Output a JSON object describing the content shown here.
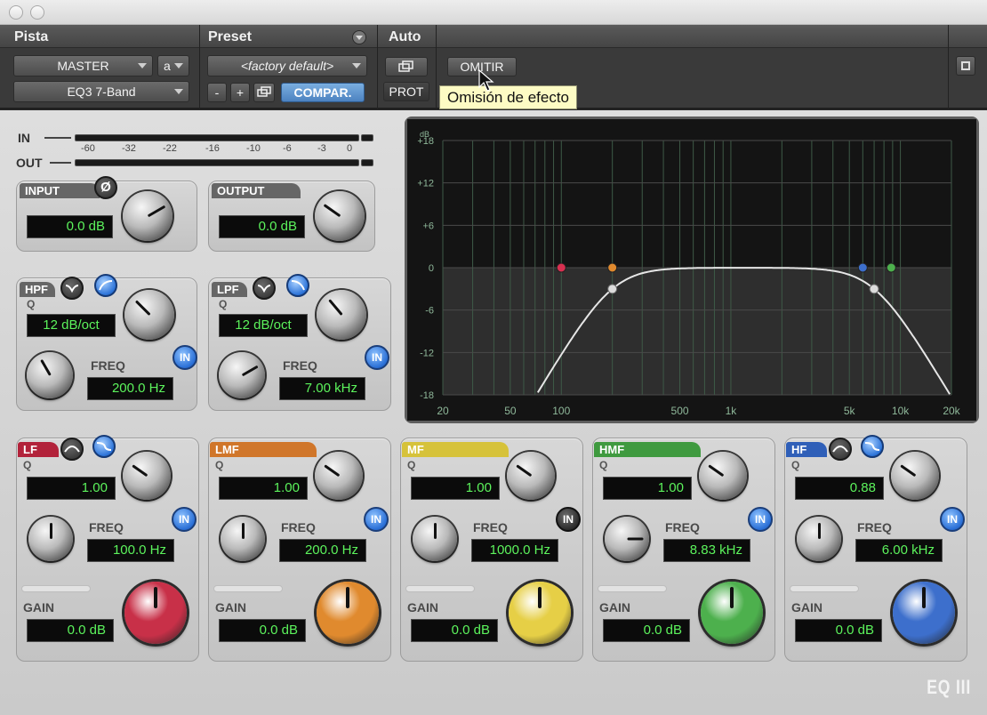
{
  "header": {
    "labels": {
      "track": "Pista",
      "preset": "Preset",
      "auto": "Auto"
    },
    "track_name": "MASTER",
    "track_channel": "a",
    "insert": "EQ3 7-Band",
    "preset_name": "<factory default>",
    "minus": "-",
    "plus": "+",
    "compare": "COMPAR.",
    "bypass": "OMITIR",
    "prot": "PROT",
    "tooltip": "Omisión de efecto"
  },
  "meters": {
    "in_label": "IN",
    "out_label": "OUT",
    "scale": [
      "-60",
      "-32",
      "-22",
      "-16",
      "-10",
      "-6",
      "-3",
      "0"
    ]
  },
  "input": {
    "label": "INPUT",
    "value": "0.0 dB",
    "phase_symbol": "Ø"
  },
  "output": {
    "label": "OUTPUT",
    "value": "0.0 dB"
  },
  "hpf": {
    "label": "HPF",
    "q_label": "Q",
    "q": "12 dB/oct",
    "freq_label": "FREQ",
    "freq": "200.0 Hz",
    "in": "IN"
  },
  "lpf": {
    "label": "LPF",
    "q_label": "Q",
    "q": "12 dB/oct",
    "freq_label": "FREQ",
    "freq": "7.00 kHz",
    "in": "IN"
  },
  "bands": [
    {
      "label": "LF",
      "color": "#b2223a",
      "q_label": "Q",
      "q": "1.00",
      "freq_label": "FREQ",
      "freq": "100.0 Hz",
      "gain_label": "GAIN",
      "gain": "0.0 dB",
      "in": "IN",
      "knob": "#c83048"
    },
    {
      "label": "LMF",
      "color": "#d0762a",
      "q_label": "Q",
      "q": "1.00",
      "freq_label": "FREQ",
      "freq": "200.0 Hz",
      "gain_label": "GAIN",
      "gain": "0.0 dB",
      "in": "IN",
      "knob": "#e08a2e"
    },
    {
      "label": "MF",
      "color": "#d6c23a",
      "q_label": "Q",
      "q": "1.00",
      "freq_label": "FREQ",
      "freq": "1000.0 Hz",
      "gain_label": "GAIN",
      "gain": "0.0 dB",
      "in": "IN",
      "knob": "#e6cf46"
    },
    {
      "label": "HMF",
      "color": "#3f9a3f",
      "q_label": "Q",
      "q": "1.00",
      "freq_label": "FREQ",
      "freq": "8.83 kHz",
      "gain_label": "GAIN",
      "gain": "0.0 dB",
      "in": "IN",
      "knob": "#4db04d"
    },
    {
      "label": "HF",
      "color": "#2f5fb8",
      "q_label": "Q",
      "q": "0.88",
      "freq_label": "FREQ",
      "freq": "6.00 kHz",
      "gain_label": "GAIN",
      "gain": "0.0 dB",
      "in": "IN",
      "knob": "#3d6fcc"
    }
  ],
  "graph": {
    "db_label": "dB",
    "db_ticks": [
      "+18",
      "+12",
      "+6",
      "0",
      "-6",
      "-12",
      "-18"
    ],
    "freq_ticks": [
      "20",
      "50",
      "100",
      "500",
      "1k",
      "5k",
      "10k",
      "20k"
    ]
  },
  "logo": "EQ III"
}
